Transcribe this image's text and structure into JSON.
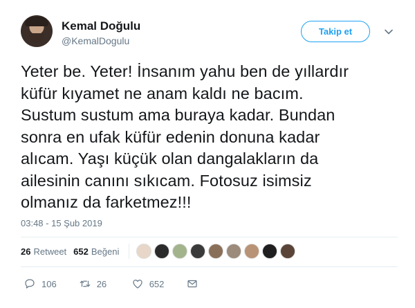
{
  "user": {
    "name": "Kemal Doğulu",
    "handle": "@KemalDogulu"
  },
  "follow_button": {
    "label": "Takip et"
  },
  "tweet": {
    "text": "Yeter be. Yeter! İnsanım yahu ben de yıllardır\nküfür kıyamet ne anam kaldı ne bacım.\nSustum sustum ama buraya kadar. Bundan\nsonra en ufak küfür edenin donuna kadar\nalıcam. Yaşı küçük olan dangalakların da\nailesinin canını sıkıcam. Fotosuz isimsiz\nolmanız da farketmez!!!",
    "timestamp": "03:48 - 15 Şub 2019"
  },
  "stats": {
    "retweet_count": "26",
    "retweet_label": "Retweet",
    "like_count": "652",
    "like_label": "Beğeni"
  },
  "likers": [
    {
      "color": "#e8d7c8"
    },
    {
      "color": "#2b2b2b"
    },
    {
      "color": "#a3b48c"
    },
    {
      "color": "#3a3a3a"
    },
    {
      "color": "#8a6f58"
    },
    {
      "color": "#9c8a7a"
    },
    {
      "color": "#b99375"
    },
    {
      "color": "#1f1f1f"
    },
    {
      "color": "#5a4438"
    }
  ],
  "actions": {
    "reply_count": "106",
    "retweet_count": "26",
    "like_count": "652"
  },
  "colors": {
    "accent": "#1da1f2",
    "text": "#14171a",
    "secondary": "#657786",
    "divider": "#e6ecf0"
  }
}
